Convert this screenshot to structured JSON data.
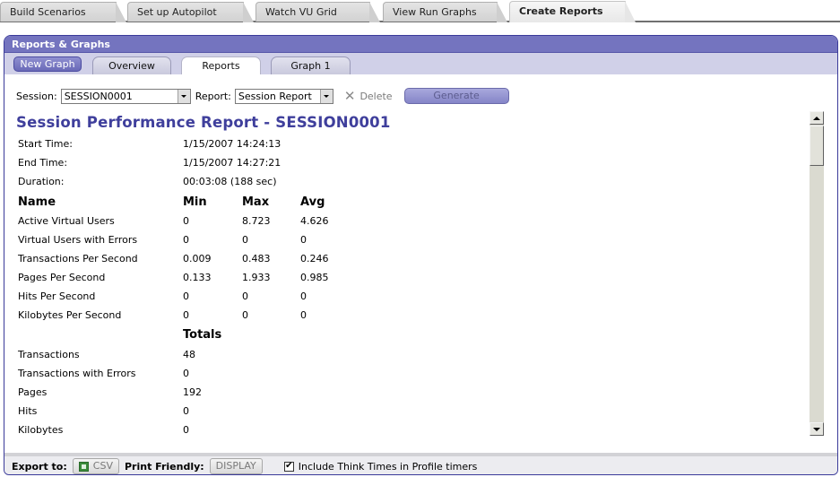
{
  "top_tabs": [
    {
      "label": "Build Scenarios",
      "active": false
    },
    {
      "label": "Set up Autopilot",
      "active": false
    },
    {
      "label": "Watch VU Grid",
      "active": false
    },
    {
      "label": "View Run Graphs",
      "active": false
    },
    {
      "label": "Create Reports",
      "active": true
    }
  ],
  "panel": {
    "title": "Reports & Graphs",
    "new_graph_label": "New Graph",
    "sub_tabs": [
      {
        "label": "Overview",
        "active": false
      },
      {
        "label": "Reports",
        "active": true
      },
      {
        "label": "Graph 1",
        "active": false
      }
    ]
  },
  "toolbar": {
    "session_label": "Session:",
    "session_value": "SESSION0001",
    "report_label": "Report:",
    "report_value": "Session Report",
    "delete_label": "Delete",
    "generate_label": "Generate"
  },
  "report": {
    "title": "Session Performance Report - SESSION0001",
    "info": [
      {
        "label": "Start Time:",
        "value": "1/15/2007 14:24:13"
      },
      {
        "label": "End Time:",
        "value": "1/15/2007 14:27:21"
      },
      {
        "label": "Duration:",
        "value": "00:03:08 (188 sec)"
      }
    ],
    "columns": [
      "Name",
      "Min",
      "Max",
      "Avg"
    ],
    "metrics": [
      {
        "name": "Active Virtual Users",
        "min": "0",
        "max": "8.723",
        "avg": "4.626"
      },
      {
        "name": "Virtual Users with Errors",
        "min": "0",
        "max": "0",
        "avg": "0"
      },
      {
        "name": "Transactions Per Second",
        "min": "0.009",
        "max": "0.483",
        "avg": "0.246"
      },
      {
        "name": "Pages Per Second",
        "min": "0.133",
        "max": "1.933",
        "avg": "0.985"
      },
      {
        "name": "Hits Per Second",
        "min": "0",
        "max": "0",
        "avg": "0"
      },
      {
        "name": "Kilobytes Per Second",
        "min": "0",
        "max": "0",
        "avg": "0"
      }
    ],
    "totals_header": "Totals",
    "totals": [
      {
        "name": "Transactions",
        "value": "48"
      },
      {
        "name": "Transactions with Errors",
        "value": "0"
      },
      {
        "name": "Pages",
        "value": "192"
      },
      {
        "name": "Hits",
        "value": "0"
      },
      {
        "name": "Kilobytes",
        "value": "0"
      }
    ]
  },
  "footer": {
    "export_label": "Export to:",
    "csv_label": "CSV",
    "print_label": "Print Friendly:",
    "display_label": "DISPLAY",
    "think_times_label": "Include Think Times in Profile timers",
    "think_times_checked": true,
    "check_glyph": "✔"
  }
}
